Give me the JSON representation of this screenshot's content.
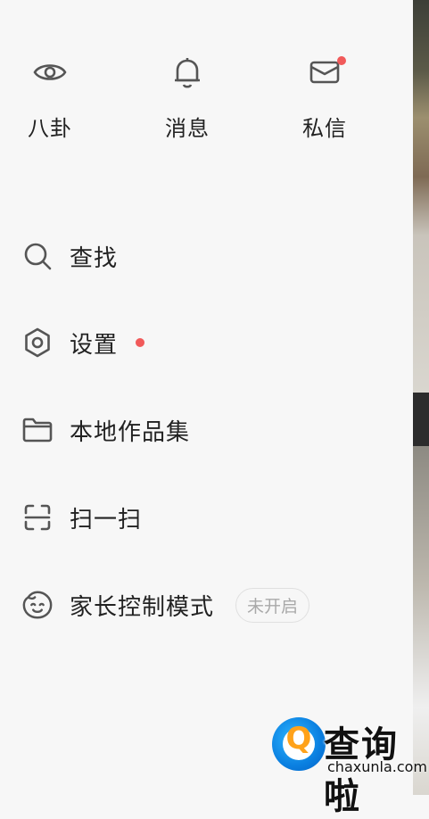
{
  "top_actions": [
    {
      "label": "八卦",
      "icon": "eye-icon"
    },
    {
      "label": "消息",
      "icon": "bell-icon"
    },
    {
      "label": "私信",
      "icon": "mail-icon",
      "badge_dot": true
    }
  ],
  "menu": [
    {
      "label": "查找",
      "icon": "search-icon"
    },
    {
      "label": "设置",
      "icon": "gear-icon",
      "badge_dot": true
    },
    {
      "label": "本地作品集",
      "icon": "folder-icon"
    },
    {
      "label": "扫一扫",
      "icon": "scan-icon"
    },
    {
      "label": "家长控制模式",
      "icon": "child-face-icon",
      "status": "未开启"
    }
  ],
  "watermark": {
    "title": "查询啦",
    "url": "chaxunla.com",
    "logo_letter": "Q"
  },
  "colors": {
    "badge_dot": "#f15a5a",
    "icon": "#555555",
    "text": "#222222",
    "background": "#f7f7f7"
  }
}
